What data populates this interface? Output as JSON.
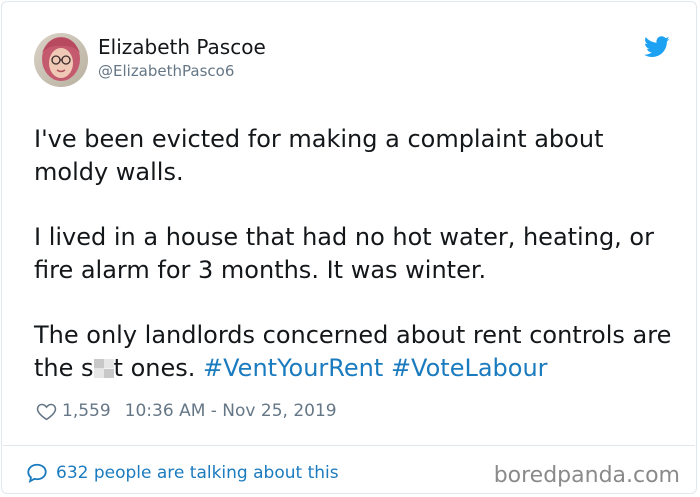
{
  "author": {
    "display_name": "Elizabeth Pascoe",
    "handle": "@ElizabethPasco6"
  },
  "tweet": {
    "paragraph1": "I've been evicted for making a complaint about moldy walls.",
    "paragraph2": "I lived in a house that had no hot water, heating, or fire alarm for 3 months. It was winter.",
    "paragraph3_before": "The only landlords concerned about rent controls are the s",
    "paragraph3_after": "t ones.",
    "hashtags": [
      "#VentYourRent",
      "#VoteLabour"
    ]
  },
  "meta": {
    "likes": "1,559",
    "timestamp": "10:36 AM - Nov 25, 2019"
  },
  "footer": {
    "talking": "632 people are talking about this"
  },
  "watermark": "boredpanda.com",
  "colors": {
    "link": "#1b7bbf",
    "twitter_blue": "#1da1f2",
    "text": "#14171a",
    "muted": "#657786"
  },
  "icons": {
    "brand": "twitter-bird-icon",
    "like": "heart-icon",
    "talk": "speech-bubble-icon"
  }
}
